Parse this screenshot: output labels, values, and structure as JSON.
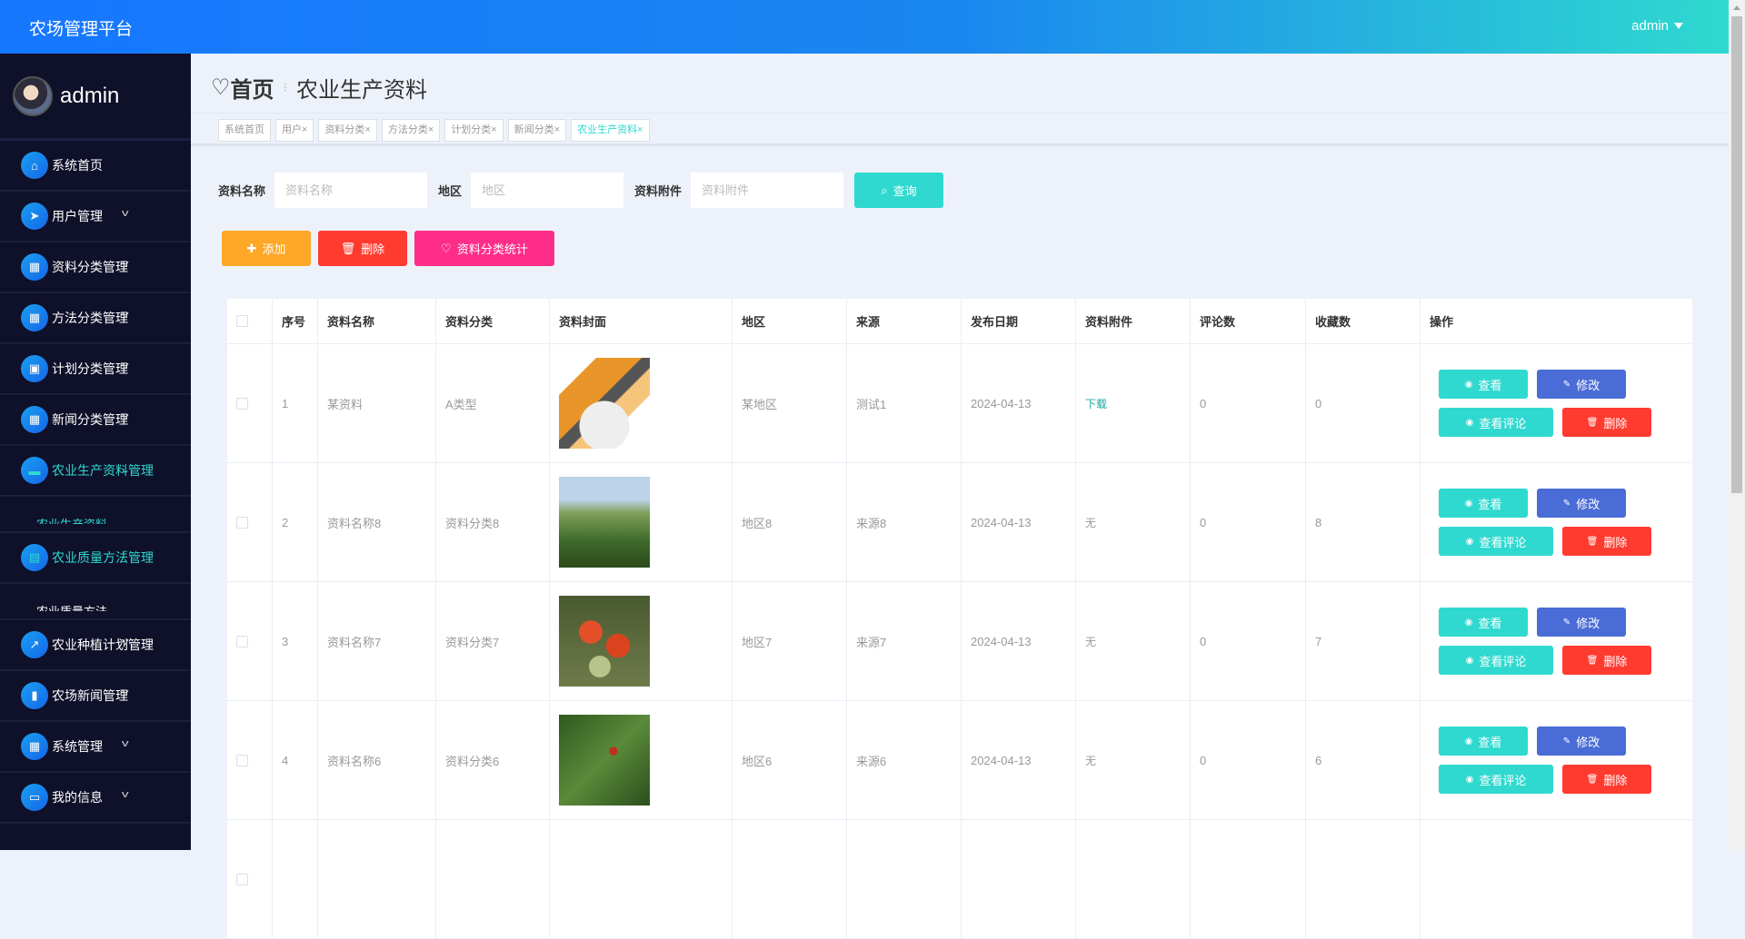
{
  "header": {
    "title": "农场管理平台",
    "user": "admin"
  },
  "sidebar": {
    "username": "admin",
    "items": [
      {
        "label": "系统首页",
        "icon": "⌂"
      },
      {
        "label": "用户管理",
        "icon": "➤",
        "chev": true
      },
      {
        "label": "资料分类管理",
        "icon": "▦",
        "chev": true
      },
      {
        "label": "方法分类管理",
        "icon": "▦",
        "chev": true
      },
      {
        "label": "计划分类管理",
        "icon": "▣",
        "chev": true
      },
      {
        "label": "新闻分类管理",
        "icon": "▦",
        "chev": true
      },
      {
        "label": "农业生产资料管理",
        "icon": "▬",
        "active": true,
        "sub": "农业生产资料"
      },
      {
        "label": "农业质量方法管理",
        "icon": "▤",
        "active": true,
        "sub": "农业质量方法"
      },
      {
        "label": "农业种植计划管理",
        "icon": "↗",
        "chev": true
      },
      {
        "label": "农场新闻管理",
        "icon": "▮",
        "chev": true
      },
      {
        "label": "系统管理",
        "icon": "▦",
        "chev": true
      },
      {
        "label": "我的信息",
        "icon": "▭",
        "chev": true
      }
    ]
  },
  "page": {
    "home": "首页",
    "title": "农业生产资料"
  },
  "tabs": [
    {
      "label": "系统首页"
    },
    {
      "label": "用户×"
    },
    {
      "label": "资料分类×"
    },
    {
      "label": "方法分类×"
    },
    {
      "label": "计划分类×"
    },
    {
      "label": "新闻分类×"
    },
    {
      "label": "农业生产资料×",
      "active": true
    }
  ],
  "search": {
    "name_label": "资料名称",
    "name_ph": "资料名称",
    "area_label": "地区",
    "area_ph": "地区",
    "file_label": "资料附件",
    "file_ph": "资料附件",
    "query": "查询"
  },
  "actions": {
    "add": "添加",
    "delete": "删除",
    "stats": "资料分类统计"
  },
  "table": {
    "headers": [
      "序号",
      "资料名称",
      "资料分类",
      "资料封面",
      "地区",
      "来源",
      "发布日期",
      "资料附件",
      "评论数",
      "收藏数",
      "操作"
    ],
    "ops": {
      "view": "查看",
      "edit": "修改",
      "comments": "查看评论",
      "delete": "删除"
    },
    "rows": [
      {
        "no": "1",
        "name": "某资料",
        "cat": "A类型",
        "cover": "illustration",
        "area": "某地区",
        "src": "测试1",
        "date": "2024-04-13",
        "file": "下载",
        "comments": "0",
        "favs": "0"
      },
      {
        "no": "2",
        "name": "资料名称8",
        "cat": "资料分类8",
        "cover": "corn",
        "area": "地区8",
        "src": "来源8",
        "date": "2024-04-13",
        "file": "无",
        "comments": "0",
        "favs": "8"
      },
      {
        "no": "3",
        "name": "资料名称7",
        "cat": "资料分类7",
        "cover": "tomato",
        "area": "地区7",
        "src": "来源7",
        "date": "2024-04-13",
        "file": "无",
        "comments": "0",
        "favs": "7"
      },
      {
        "no": "4",
        "name": "资料名称6",
        "cat": "资料分类6",
        "cover": "pepper",
        "area": "地区6",
        "src": "来源6",
        "date": "2024-04-13",
        "file": "无",
        "comments": "0",
        "favs": "6"
      }
    ]
  }
}
